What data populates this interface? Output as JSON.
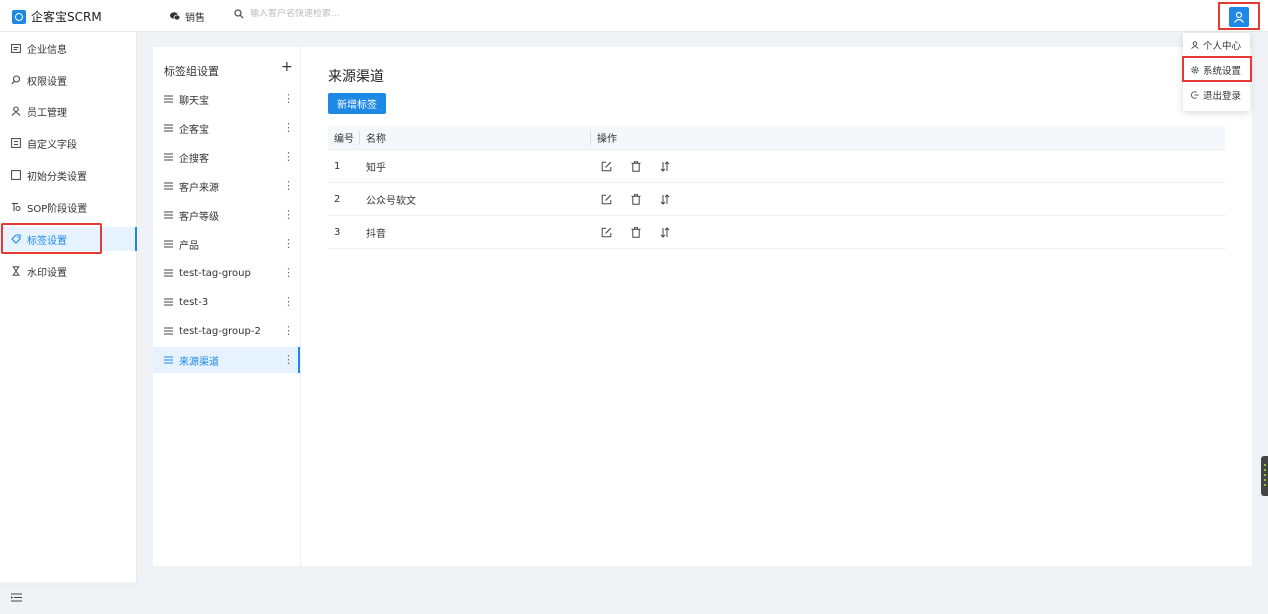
{
  "app": {
    "title": "企客宝SCRM"
  },
  "header": {
    "nav_sales": "销售",
    "search_placeholder": "输入客户名快速检索..."
  },
  "sidebar": {
    "items": [
      {
        "label": "企业信息",
        "icon": "id-card-icon"
      },
      {
        "label": "权限设置",
        "icon": "search-icon"
      },
      {
        "label": "员工管理",
        "icon": "user-icon"
      },
      {
        "label": "自定义字段",
        "icon": "form-icon"
      },
      {
        "label": "初始分类设置",
        "icon": "square-icon"
      },
      {
        "label": "SOP阶段设置",
        "icon": "flow-icon"
      },
      {
        "label": "标签设置",
        "icon": "tag-icon",
        "active": true
      },
      {
        "label": "水印设置",
        "icon": "hourglass-icon"
      }
    ]
  },
  "tag_groups": {
    "title": "标签组设置",
    "add": "+",
    "items": [
      "聊天宝",
      "企客宝",
      "企搜客",
      "客户来源",
      "客户等级",
      "产品",
      "test-tag-group",
      "test-3",
      "test-tag-group-2",
      "来源渠道"
    ],
    "active_index": 9
  },
  "main": {
    "title": "来源渠道",
    "add_button": "新增标签",
    "columns": {
      "no": "编号",
      "name": "名称",
      "ops": "操作"
    },
    "rows": [
      {
        "no": "1",
        "name": "知乎"
      },
      {
        "no": "2",
        "name": "公众号软文"
      },
      {
        "no": "3",
        "name": "抖音"
      }
    ]
  },
  "user_menu": {
    "items": [
      {
        "label": "个人中心",
        "icon": "user-icon"
      },
      {
        "label": "系统设置",
        "icon": "gear-icon"
      },
      {
        "label": "退出登录",
        "icon": "logout-icon"
      }
    ]
  },
  "colors": {
    "accent": "#1e88e5",
    "highlight": "#e53935",
    "active_bg": "#e6f3ff"
  }
}
